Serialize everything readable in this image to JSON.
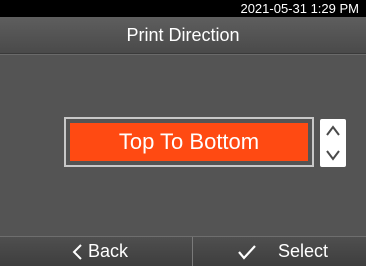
{
  "status_bar": {
    "datetime": "2021-05-31  1:29 PM"
  },
  "header": {
    "title": "Print Direction"
  },
  "selector": {
    "value": "Top To Bottom",
    "up_icon": "chevron-up-icon",
    "down_icon": "chevron-down-icon"
  },
  "footer": {
    "back_label": "Back",
    "back_icon": "chevron-left-icon",
    "select_label": "Select",
    "select_icon": "checkmark-icon"
  },
  "colors": {
    "background": "#545454",
    "accent": "#ff4a12",
    "status_bar": "#000000",
    "text": "#ffffff"
  }
}
